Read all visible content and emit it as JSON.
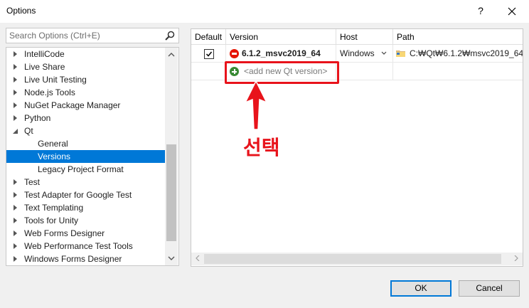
{
  "window": {
    "title": "Options",
    "help_label": "?"
  },
  "search": {
    "placeholder": "Search Options (Ctrl+E)",
    "value": ""
  },
  "tree": {
    "items": [
      {
        "label": "IntelliCode",
        "state": "collapsed"
      },
      {
        "label": "Live Share",
        "state": "collapsed"
      },
      {
        "label": "Live Unit Testing",
        "state": "collapsed"
      },
      {
        "label": "Node.js Tools",
        "state": "collapsed"
      },
      {
        "label": "NuGet Package Manager",
        "state": "collapsed"
      },
      {
        "label": "Python",
        "state": "collapsed"
      },
      {
        "label": "Qt",
        "state": "expanded"
      },
      {
        "label": "General",
        "state": "child"
      },
      {
        "label": "Versions",
        "state": "child-selected"
      },
      {
        "label": "Legacy Project Format",
        "state": "child"
      },
      {
        "label": "Test",
        "state": "collapsed"
      },
      {
        "label": "Test Adapter for Google Test",
        "state": "collapsed"
      },
      {
        "label": "Text Templating",
        "state": "collapsed"
      },
      {
        "label": "Tools for Unity",
        "state": "collapsed"
      },
      {
        "label": "Web Forms Designer",
        "state": "collapsed"
      },
      {
        "label": "Web Performance Test Tools",
        "state": "collapsed"
      },
      {
        "label": "Windows Forms Designer",
        "state": "collapsed"
      }
    ]
  },
  "grid": {
    "columns": [
      "Default",
      "Version",
      "Host",
      "Path"
    ],
    "rows": [
      {
        "default_checked": true,
        "version": "6.1.2_msvc2019_64",
        "host": "Windows",
        "path": "C:₩Qt₩6.1.2₩msvc2019_64"
      }
    ],
    "add_label": "<add new Qt version>"
  },
  "annotation": {
    "text": "선택",
    "color": "#e8131b"
  },
  "buttons": {
    "ok": "OK",
    "cancel": "Cancel"
  },
  "colors": {
    "selection": "#0078d7",
    "error_icon": "#e51400",
    "add_icon": "#388a34"
  }
}
